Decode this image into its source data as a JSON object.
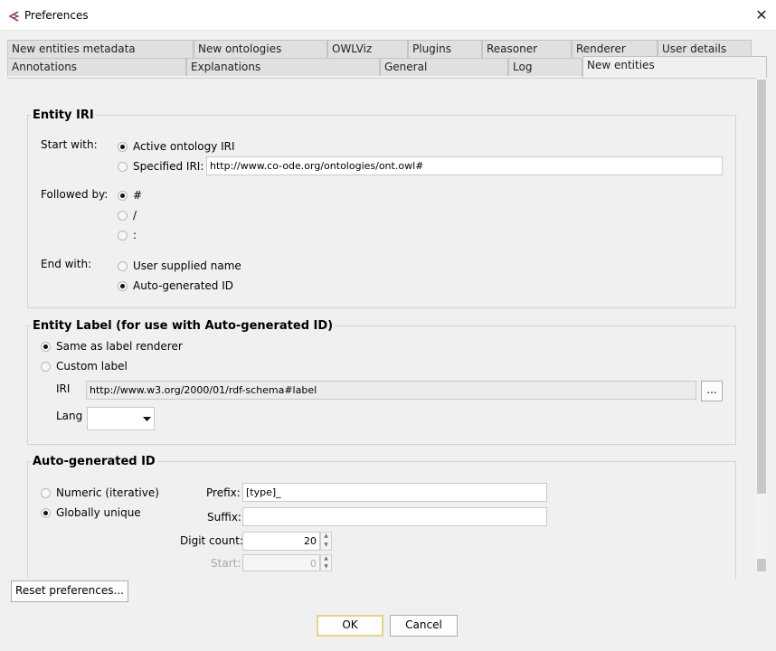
{
  "window": {
    "title": "Preferences",
    "close": "✕"
  },
  "tabs_row1": [
    "New entities metadata",
    "New ontologies",
    "OWLViz",
    "Plugins",
    "Reasoner",
    "Renderer",
    "User details"
  ],
  "tabs_row2": [
    "Annotations",
    "Explanations",
    "General",
    "Log",
    "New entities"
  ],
  "entity_iri": {
    "title": "Entity IRI",
    "start_with": "Start with:",
    "active_ontology_iri": "Active ontology IRI",
    "specified_iri": "Specified IRI:",
    "specified_iri_value": "http://www.co-ode.org/ontologies/ont.owl#",
    "followed_by": "Followed by:",
    "sep_hash": "#",
    "sep_slash": "/",
    "sep_colon": ":",
    "end_with": "End with:",
    "user_supplied_name": "User supplied name",
    "auto_generated_id": "Auto-generated ID"
  },
  "entity_label": {
    "title": "Entity Label (for use with Auto-generated ID)",
    "same_as_renderer": "Same as label renderer",
    "custom_label": "Custom label",
    "iri_label": "IRI",
    "iri_value": "http://www.w3.org/2000/01/rdf-schema#label",
    "browse": "...",
    "lang_label": "Lang",
    "lang_value": ""
  },
  "auto_id": {
    "title": "Auto-generated ID",
    "numeric": "Numeric (iterative)",
    "globally_unique": "Globally unique",
    "prefix_label": "Prefix:",
    "prefix_value": "[type]_",
    "suffix_label": "Suffix:",
    "suffix_value": "",
    "digit_count_label": "Digit count:",
    "digit_count_value": "20",
    "start_label": "Start:",
    "start_value": "0"
  },
  "footer": {
    "reset": "Reset preferences...",
    "ok": "OK",
    "cancel": "Cancel"
  },
  "colors": {
    "window_bg": "#f0f0f0",
    "tab_bg": "#e0e0e0",
    "ok_border": "#e2d28c"
  }
}
